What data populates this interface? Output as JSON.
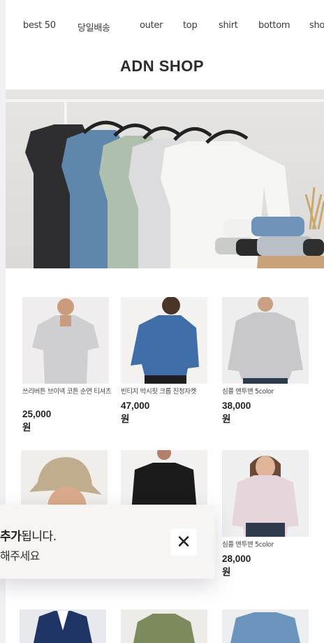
{
  "nav": {
    "items": [
      "best 50",
      "당일배송",
      "outer",
      "top",
      "shirt",
      "bottom",
      "sho"
    ]
  },
  "shop": {
    "title": "ADN SHOP"
  },
  "products": [
    {
      "name": "쓰리버튼 브이넥 코튼 순면 티셔츠",
      "price": "25,000원"
    },
    {
      "name": "빈티지 박시핏 크롭 진청자켓",
      "price": "47,000원"
    },
    {
      "name": "심플 맨투맨 5color",
      "price": "38,000원"
    },
    {
      "name": "",
      "price": ""
    },
    {
      "name": "",
      "price": ""
    },
    {
      "name": "심플 맨투맨 5color",
      "price": "28,000원"
    }
  ],
  "toast": {
    "line1_bold": "추가",
    "line1_rest": "됩니다.",
    "line2": "해주세요",
    "close_icon": "close-icon"
  }
}
